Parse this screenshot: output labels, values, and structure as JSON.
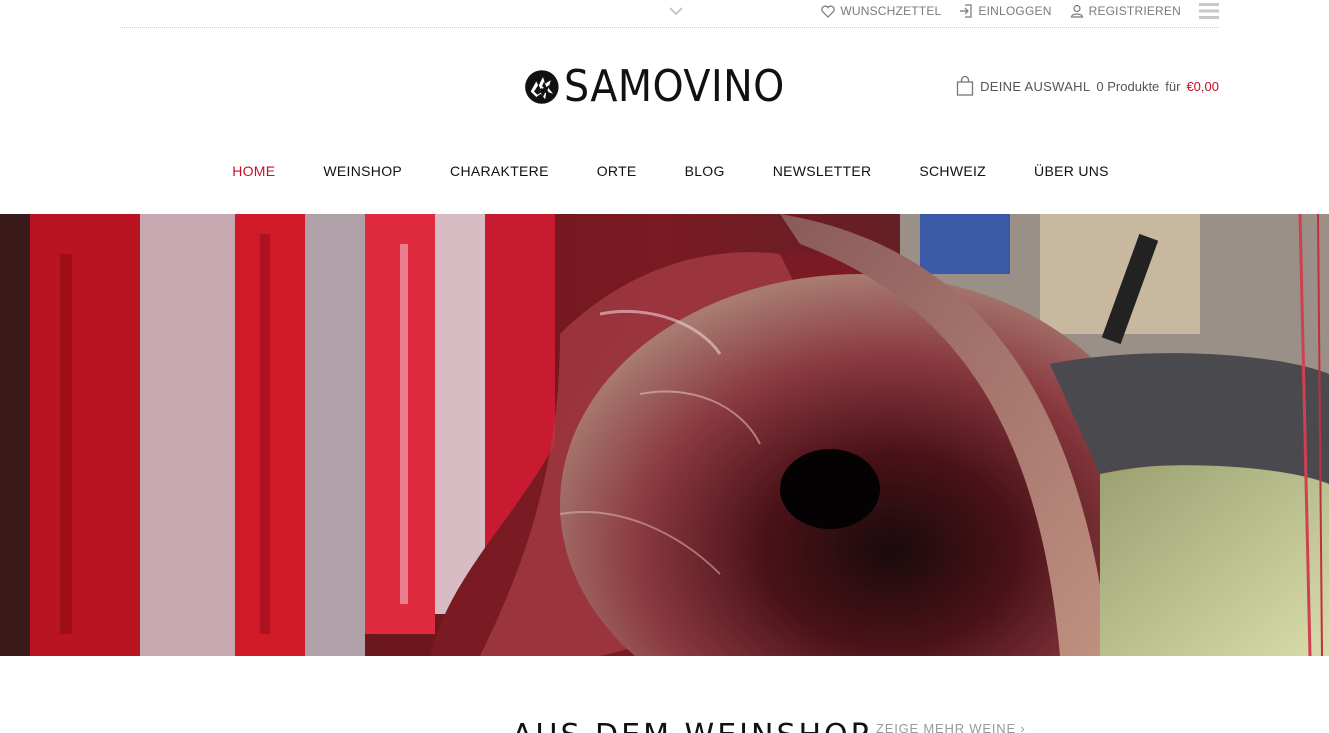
{
  "topbar": {
    "wishlist_label": "WUNSCHZETTEL",
    "login_label": "EINLOGGEN",
    "register_label": "REGISTRIEREN"
  },
  "logo": {
    "text": "SAMOVINO"
  },
  "cart": {
    "label": "DEINE AUSWAHL",
    "count": "0 Produkte",
    "for": "für",
    "price": "€0,00"
  },
  "nav": {
    "items": [
      {
        "label": "HOME"
      },
      {
        "label": "WEINSHOP"
      },
      {
        "label": "CHARAKTERE"
      },
      {
        "label": "ORTE"
      },
      {
        "label": "BLOG"
      },
      {
        "label": "NEWSLETTER"
      },
      {
        "label": "SCHWEIZ"
      },
      {
        "label": "ÜBER UNS"
      }
    ],
    "active": "HOME"
  },
  "section": {
    "title": "AUS DEM WEINSHOP",
    "more_label": "ZEIGE MEHR WEINE ›"
  },
  "colors": {
    "accent": "#c0102a",
    "muted": "#7a7a7a"
  },
  "icons": {
    "topbar": [
      "chevron-down-icon",
      "heart-icon",
      "login-icon",
      "user-icon",
      "menu-icon"
    ],
    "cart": "shopping-bag-icon",
    "logo": "wolf-icon"
  }
}
